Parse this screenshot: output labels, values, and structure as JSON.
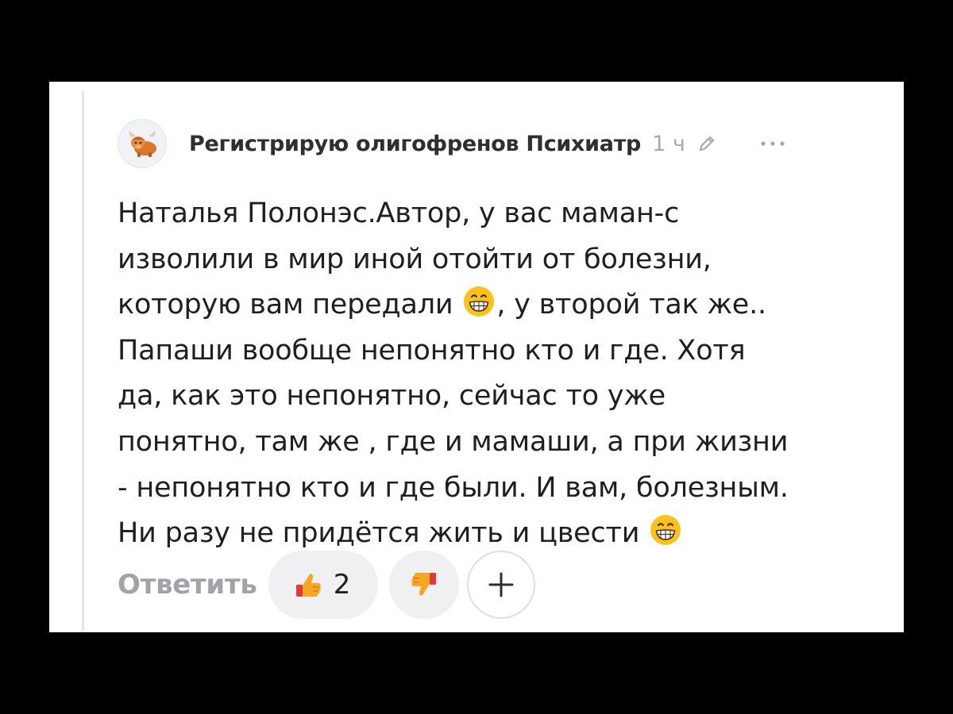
{
  "comment": {
    "author": "Регистрирую олигофренов Психиатр",
    "time": "1 ч",
    "avatar_icon": "yak-icon",
    "text_lines": [
      {
        "before": "Наталья Полонэс.Автор, у вас маман-с",
        "emoji": false,
        "after": ""
      },
      {
        "before": "изволили в мир иной отойти от болезни,",
        "emoji": false,
        "after": ""
      },
      {
        "before": "которую вам передали ",
        "emoji": true,
        "after": ", у второй так же.."
      },
      {
        "before": "Папаши вообще непонятно кто и где. Хотя",
        "emoji": false,
        "after": ""
      },
      {
        "before": "да, как это непонятно, сейчас то уже",
        "emoji": false,
        "after": ""
      },
      {
        "before": "понятно, там же , где и мамаши, а при жизни",
        "emoji": false,
        "after": ""
      },
      {
        "before": "- непонятно кто и где были. И вам, болезным.",
        "emoji": false,
        "after": ""
      },
      {
        "before": "Ни разу не придётся жить и цвести ",
        "emoji": true,
        "after": ""
      }
    ],
    "emoji_name": "grinning-face-icon"
  },
  "actions": {
    "reply_label": "Ответить",
    "like_count": "2",
    "like_icon": "thumbs-up-icon",
    "dislike_icon": "thumbs-down-icon",
    "add_icon": "plus-icon"
  },
  "colors": {
    "background": "#000000",
    "card": "#ffffff",
    "author_text": "#2e2f33",
    "muted_text": "#a8a9ad",
    "body_text": "#1f1f22",
    "pill_bg": "#f0f0f2",
    "emoji_thumb": "#f5a623",
    "thumb_cuff": "#e53935"
  }
}
